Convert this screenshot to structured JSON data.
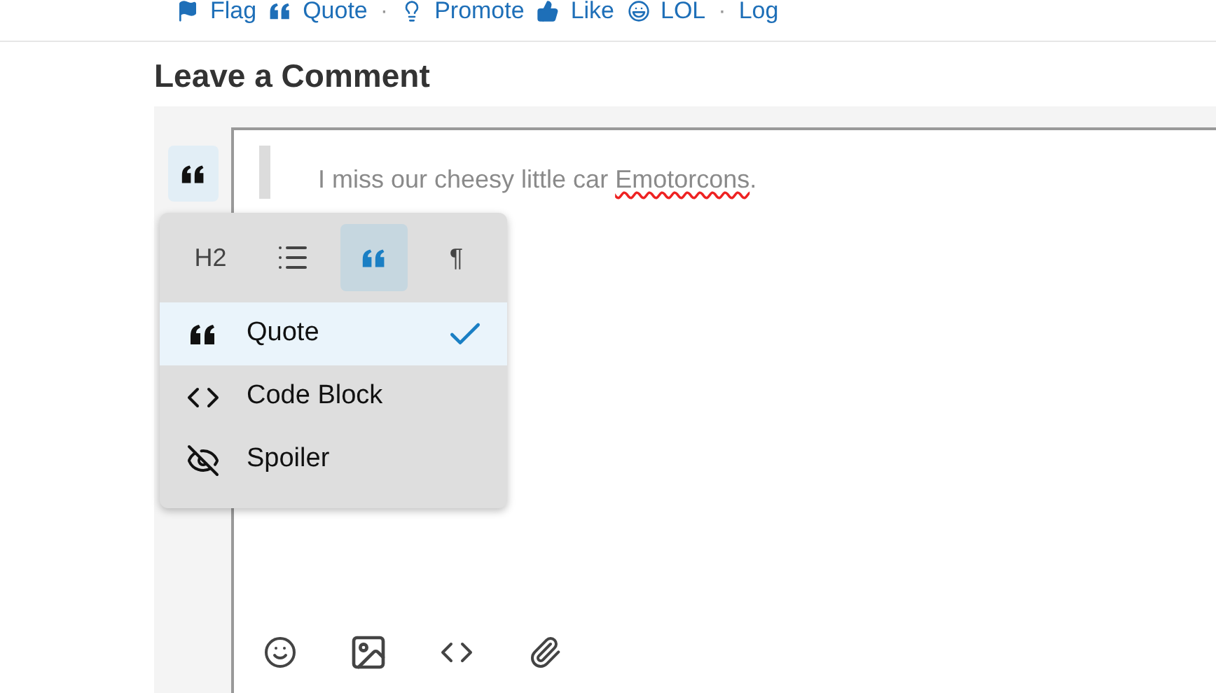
{
  "actions": [
    {
      "kind": "flag",
      "label": "Flag"
    },
    {
      "kind": "quote",
      "label": "Quote"
    },
    {
      "kind": "sep",
      "label": "·"
    },
    {
      "kind": "bulb",
      "label": "Promote"
    },
    {
      "kind": "like",
      "label": "Like"
    },
    {
      "kind": "laugh",
      "label": "LOL"
    },
    {
      "kind": "sep",
      "label": "·"
    },
    {
      "kind": "plain",
      "label": "Log"
    }
  ],
  "heading": "Leave a Comment",
  "editor": {
    "misspelled": "Emotorcons",
    "after": ".",
    "prefix": "I miss our cheesy little car "
  },
  "format_menu": {
    "styles": [
      {
        "kind": "text",
        "label": "H2",
        "selected": false
      },
      {
        "kind": "list",
        "selected": false
      },
      {
        "kind": "quote",
        "selected": true
      },
      {
        "kind": "text",
        "label": "¶",
        "selected": false
      }
    ],
    "items": [
      {
        "kind": "quote",
        "label": "Quote",
        "selected": true
      },
      {
        "kind": "code",
        "label": "Code Block",
        "selected": false
      },
      {
        "kind": "spoiler",
        "label": "Spoiler",
        "selected": false
      }
    ]
  },
  "toolbar": [
    {
      "kind": "emoji"
    },
    {
      "kind": "image"
    },
    {
      "kind": "code"
    },
    {
      "kind": "attach"
    }
  ]
}
